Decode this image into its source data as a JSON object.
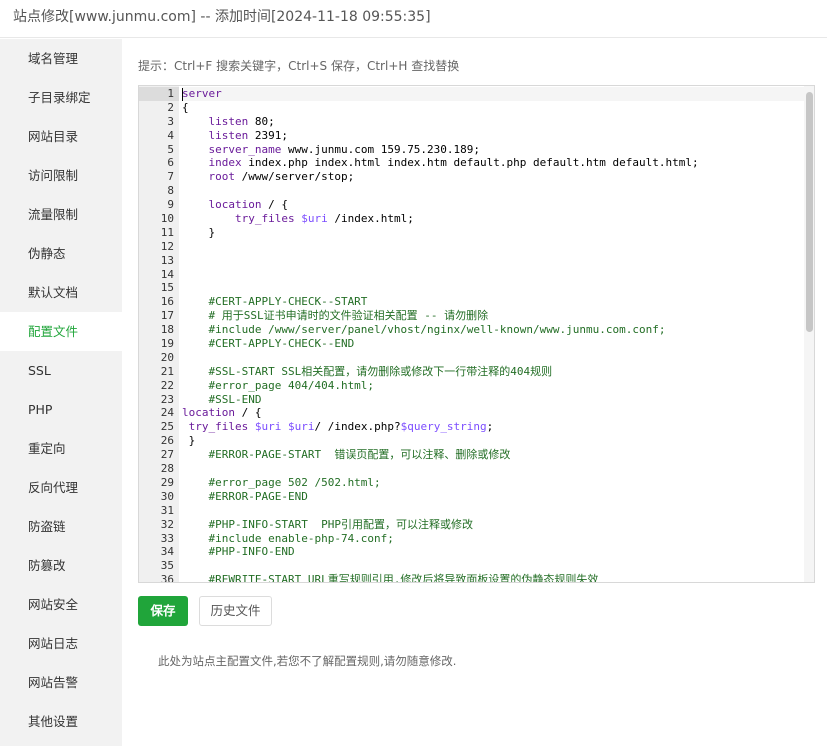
{
  "window": {
    "title": "站点修改[www.junmu.com] -- 添加时间[2024-11-18 09:55:35]"
  },
  "sidebar": {
    "items": [
      {
        "label": "域名管理"
      },
      {
        "label": "子目录绑定"
      },
      {
        "label": "网站目录"
      },
      {
        "label": "访问限制"
      },
      {
        "label": "流量限制"
      },
      {
        "label": "伪静态"
      },
      {
        "label": "默认文档"
      },
      {
        "label": "配置文件"
      },
      {
        "label": "SSL"
      },
      {
        "label": "PHP"
      },
      {
        "label": "重定向"
      },
      {
        "label": "反向代理"
      },
      {
        "label": "防盗链"
      },
      {
        "label": "防篡改"
      },
      {
        "label": "网站安全"
      },
      {
        "label": "网站日志"
      },
      {
        "label": "网站告警"
      },
      {
        "label": "其他设置"
      }
    ],
    "active_index": 7
  },
  "main": {
    "hint": "提示：Ctrl+F 搜索关键字，Ctrl+S 保存，Ctrl+H 查找替换",
    "save_label": "保存",
    "history_label": "历史文件",
    "note": "此处为站点主配置文件,若您不了解配置规则,请勿随意修改."
  },
  "editor": {
    "active_line": 1,
    "lines": [
      {
        "n": "1",
        "t": "server"
      },
      {
        "n": "2",
        "t": "{"
      },
      {
        "n": "3",
        "t": "    listen 80;"
      },
      {
        "n": "4",
        "t": "    listen 2391;"
      },
      {
        "n": "5",
        "t": "    server_name www.junmu.com 159.75.230.189;"
      },
      {
        "n": "6",
        "t": "    index index.php index.html index.htm default.php default.htm default.html;"
      },
      {
        "n": "7",
        "t": "    root /www/server/stop;"
      },
      {
        "n": "8",
        "t": ""
      },
      {
        "n": "9",
        "t": "    location / {"
      },
      {
        "n": "10",
        "t": "        try_files $uri /index.html;"
      },
      {
        "n": "11",
        "t": "    }"
      },
      {
        "n": "12",
        "t": ""
      },
      {
        "n": "13",
        "t": ""
      },
      {
        "n": "14",
        "t": ""
      },
      {
        "n": "15",
        "t": ""
      },
      {
        "n": "16",
        "t": "    #CERT-APPLY-CHECK--START"
      },
      {
        "n": "17",
        "t": "    # 用于SSL证书申请时的文件验证相关配置 -- 请勿删除"
      },
      {
        "n": "18",
        "t": "    #include /www/server/panel/vhost/nginx/well-known/www.junmu.com.conf;"
      },
      {
        "n": "19",
        "t": "    #CERT-APPLY-CHECK--END"
      },
      {
        "n": "20",
        "t": ""
      },
      {
        "n": "21",
        "t": "    #SSL-START SSL相关配置，请勿删除或修改下一行带注释的404规则"
      },
      {
        "n": "22",
        "t": "    #error_page 404/404.html;"
      },
      {
        "n": "23",
        "t": "    #SSL-END"
      },
      {
        "n": "24",
        "t": "location / {"
      },
      {
        "n": "25",
        "t": " try_files $uri $uri/ /index.php?$query_string;"
      },
      {
        "n": "26",
        "t": " }"
      },
      {
        "n": "27",
        "t": "    #ERROR-PAGE-START  错误页配置，可以注释、删除或修改"
      },
      {
        "n": "28",
        "t": ""
      },
      {
        "n": "29",
        "t": "    #error_page 502 /502.html;"
      },
      {
        "n": "30",
        "t": "    #ERROR-PAGE-END"
      },
      {
        "n": "31",
        "t": ""
      },
      {
        "n": "32",
        "t": "    #PHP-INFO-START  PHP引用配置，可以注释或修改"
      },
      {
        "n": "33",
        "t": "    #include enable-php-74.conf;"
      },
      {
        "n": "34",
        "t": "    #PHP-INFO-END"
      },
      {
        "n": "35",
        "t": ""
      },
      {
        "n": "36",
        "t": "    #REWRITE-START URL重写规则引用,修改后将导致面板设置的伪静态规则失效"
      }
    ]
  }
}
